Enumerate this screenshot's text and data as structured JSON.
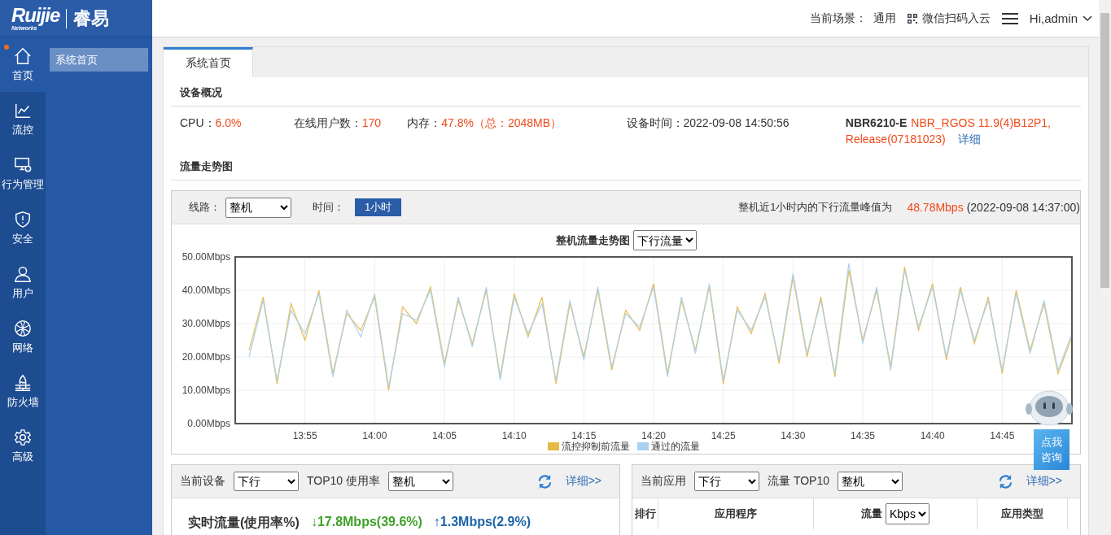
{
  "header": {
    "scene_label": "当前场景：",
    "scene_value": "通用",
    "cloud_link": "微信扫码入云",
    "user": "Hi,admin"
  },
  "logo": {
    "brand": "Ruijie",
    "tagline": "Networks",
    "product": "睿易"
  },
  "nav": [
    {
      "label": "首页",
      "selected": true,
      "dot": true
    },
    {
      "label": "流控",
      "selected": false,
      "dot": false
    },
    {
      "label": "行为管理",
      "selected": false,
      "dot": false
    },
    {
      "label": "安全",
      "selected": false,
      "dot": false
    },
    {
      "label": "用户",
      "selected": false,
      "dot": false
    },
    {
      "label": "网络",
      "selected": false,
      "dot": false
    },
    {
      "label": "防火墙",
      "selected": false,
      "dot": false
    },
    {
      "label": "高级",
      "selected": false,
      "dot": false
    }
  ],
  "submenu": [
    {
      "label": "系统首页",
      "selected": true
    }
  ],
  "tabs": [
    {
      "label": "系统首页",
      "selected": true
    }
  ],
  "overview": {
    "title": "设备概况",
    "cpu_label": "CPU：",
    "cpu": "6.0%",
    "users_label": "在线用户数：",
    "users": "170",
    "mem_label": "内存：",
    "mem": "47.8%（总：2048MB）",
    "time_label": "设备时间：",
    "time": "2022-09-08 14:50:56",
    "model": "NBR6210-E",
    "version_line1": "NBR_RGOS 11.9(4)B12P1,",
    "version_line2": "Release(07181023)",
    "detail": "详细"
  },
  "trend": {
    "title": "流量走势图",
    "line_label": "线路：",
    "line_value": "整机",
    "time_label": "时间：",
    "time_buttons": [
      {
        "label": "1小时",
        "selected": true
      }
    ],
    "peak_text": "整机近1小时内的下行流量峰值为",
    "peak_value": "48.78Mbps",
    "peak_time": "(2022-09-08 14:37:00)",
    "chart_title": "整机流量走势图",
    "direction": "下行流量",
    "chart_data": {
      "type": "line",
      "categories": [
        null,
        null,
        null,
        null,
        "13:55",
        null,
        null,
        null,
        null,
        "14:00",
        null,
        null,
        null,
        null,
        "14:05",
        null,
        null,
        null,
        null,
        "14:10",
        null,
        null,
        null,
        null,
        "14:15",
        null,
        null,
        null,
        null,
        "14:20",
        null,
        null,
        null,
        null,
        "14:25",
        null,
        null,
        null,
        null,
        "14:30",
        null,
        null,
        null,
        null,
        "14:35",
        null,
        null,
        null,
        null,
        "14:40",
        null,
        null,
        null,
        null,
        "14:45",
        null,
        null,
        null,
        null,
        null
      ],
      "series": [
        {
          "name": "流控抑制前流量",
          "color": "#e6b948",
          "values": [
            22,
            38,
            12,
            36,
            25,
            40,
            15,
            33,
            28,
            38,
            10,
            35,
            30,
            41,
            18,
            37,
            24,
            40,
            14,
            39,
            26,
            38,
            12,
            36,
            20,
            40,
            16,
            34,
            28,
            42,
            15,
            37,
            22,
            41,
            12,
            35,
            27,
            39,
            18,
            44,
            20,
            38,
            14,
            46,
            25,
            40,
            17,
            47,
            28,
            42,
            19,
            41,
            24,
            38,
            15,
            40,
            22,
            36,
            15,
            26
          ]
        },
        {
          "name": "通过的流量",
          "color": "#a9d0ef",
          "values": [
            20,
            37,
            13,
            34,
            27,
            39,
            14,
            34,
            26,
            39,
            11,
            33,
            31,
            40,
            17,
            38,
            23,
            41,
            13,
            38,
            27,
            36,
            13,
            37,
            19,
            41,
            17,
            33,
            29,
            41,
            14,
            38,
            21,
            42,
            13,
            34,
            28,
            38,
            19,
            45,
            21,
            37,
            15,
            48,
            24,
            41,
            16,
            46,
            29,
            41,
            20,
            40,
            25,
            37,
            16,
            39,
            21,
            37,
            16,
            27
          ]
        }
      ],
      "ylim": [
        0,
        50
      ],
      "grid": true,
      "legend": "bottom",
      "yticks": [
        {
          "value": 0,
          "label": "0.00Mbps"
        },
        {
          "value": 10,
          "label": "10.00Mbps"
        },
        {
          "value": 20,
          "label": "20.00Mbps"
        },
        {
          "value": 30,
          "label": "30.00Mbps"
        },
        {
          "value": 40,
          "label": "40.00Mbps"
        },
        {
          "value": 50,
          "label": "50.00Mbps"
        }
      ]
    }
  },
  "assistant": {
    "label": "点我咨询"
  },
  "device_panel": {
    "label": "当前设备",
    "direction": "下行",
    "top_label": "TOP10 使用率",
    "scope": "整机",
    "detail": "详细>>",
    "realtime_label": "实时流量(使用率%)",
    "down": "↓17.8Mbps(39.6%)",
    "up": "↑1.3Mbps(2.9%)"
  },
  "app_panel": {
    "label": "当前应用",
    "direction": "下行",
    "top_label": "流量 TOP10",
    "scope": "整机",
    "detail": "详细>>",
    "columns": [
      "排行",
      "应用程序",
      "流量",
      "应用类型"
    ],
    "unit": "Kbps"
  }
}
